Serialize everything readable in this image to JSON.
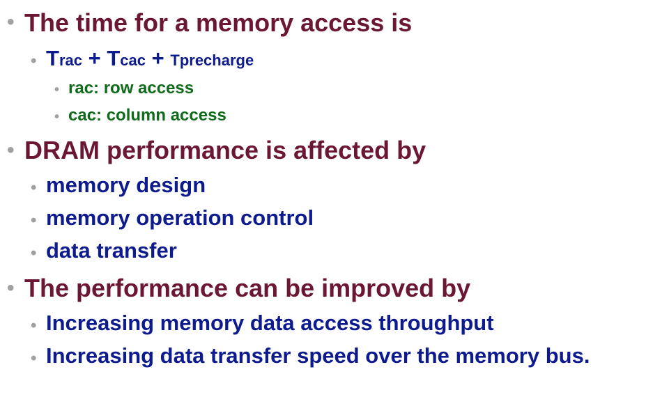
{
  "sections": [
    {
      "heading": "The time for a memory access is",
      "formula": {
        "t1": "T",
        "s1": "rac",
        "p1": "+",
        "t2": "T",
        "s2": "cac",
        "p2": "+",
        "t3": "T",
        "s3": "precharge"
      },
      "subitems": [
        "rac: row access",
        "cac: column access"
      ]
    },
    {
      "heading": "DRAM performance is affected by",
      "items": [
        "memory design",
        "memory operation control",
        "data transfer"
      ]
    },
    {
      "heading": "The performance can be improved by",
      "items": [
        "Increasing memory data access throughput",
        "Increasing data transfer speed over the memory bus."
      ]
    }
  ],
  "bullet_glyph": "•",
  "colors": {
    "heading": "#6b1635",
    "level2": "#0d1b8f",
    "level3": "#0f6b1a",
    "bullet": "#a0a0a0"
  }
}
